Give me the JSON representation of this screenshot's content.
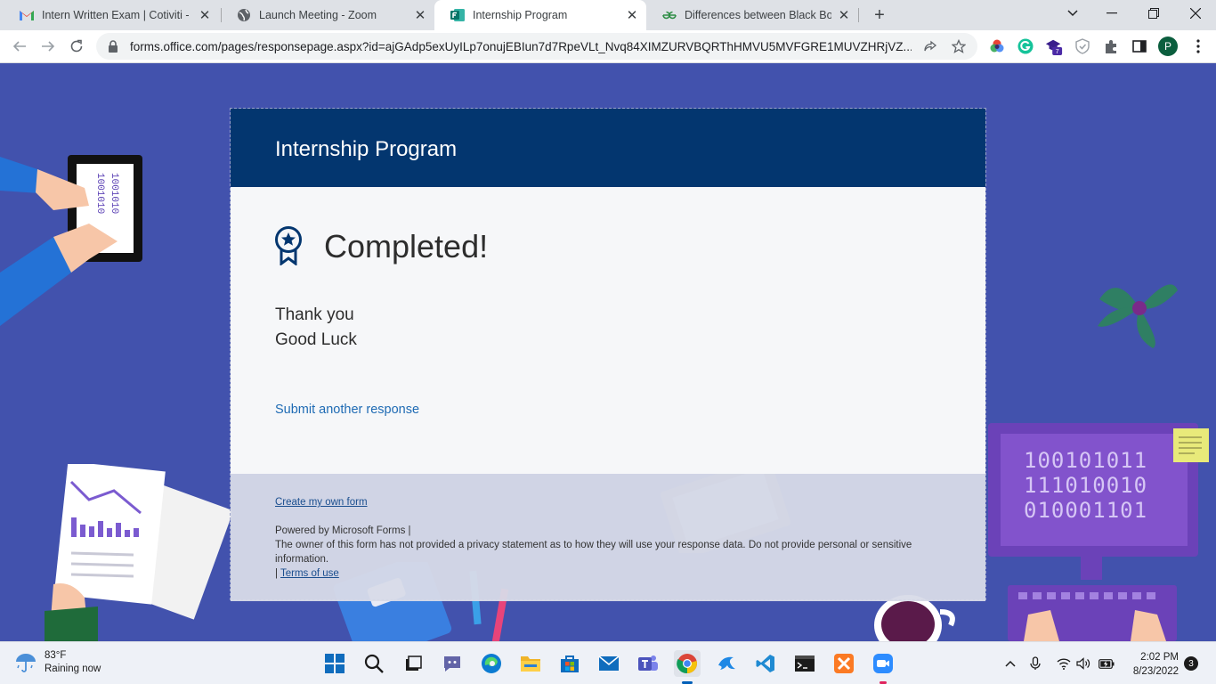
{
  "browser": {
    "tabs": [
      {
        "title": "Intern Written Exam | Cotiviti - pr",
        "icon": "gmail-icon"
      },
      {
        "title": "Launch Meeting - Zoom",
        "icon": "globe-icon"
      },
      {
        "title": "Internship Program",
        "icon": "forms-icon",
        "active": true
      },
      {
        "title": "Differences between Black Box Te",
        "icon": "geeksforgeeks-icon"
      }
    ],
    "url": "forms.office.com/pages/responsepage.aspx?id=ajGAdp5exUyILp7onujEBIun7d7RpeVLt_Nvq84XIMZURVBQRThHMVU5MVFGRE1MUVZHRjVZ...",
    "profile_initial": "P",
    "extension_badge": "7"
  },
  "form": {
    "title": "Internship Program",
    "status": "Completed!",
    "messages": [
      "Thank you",
      "Good Luck"
    ],
    "submit_another": "Submit another response"
  },
  "footer": {
    "create_link": "Create my own form",
    "powered": "Powered by Microsoft Forms |",
    "privacy": "The owner of this form has not provided a privacy statement as to how they will use your response data. Do not provide personal or sensitive information.",
    "terms_prefix": "|",
    "terms_link": "Terms of use"
  },
  "background": {
    "binary_lines": [
      "100101011",
      "111010010",
      "010001101"
    ],
    "tablet_text": "1001010"
  },
  "taskbar": {
    "temperature": "83°F",
    "condition": "Raining now",
    "time": "2:02 PM",
    "date": "8/23/2022",
    "notifications": "3"
  },
  "colors": {
    "page_bg": "#4252ad",
    "header_bg": "#03366f",
    "link": "#1f6bb4"
  }
}
